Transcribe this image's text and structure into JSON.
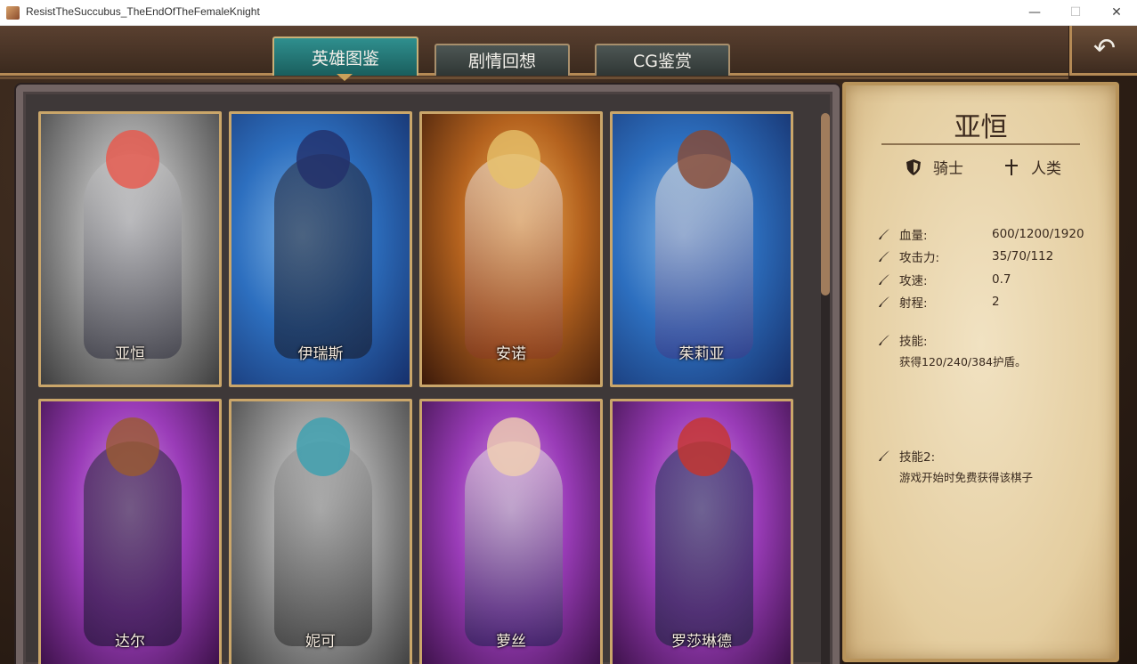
{
  "window": {
    "title": "ResistTheSuccubus_TheEndOfTheFemaleKnight",
    "min_glyph": "—",
    "max_glyph": "☐",
    "close_glyph": "✕"
  },
  "tabs": [
    {
      "label": "英雄图鉴",
      "active": true
    },
    {
      "label": "剧情回想",
      "active": false
    },
    {
      "label": "CG鉴赏",
      "active": false
    }
  ],
  "back_button": {
    "icon": "back-arrow-icon",
    "glyph": "↶"
  },
  "heroes": [
    {
      "name": "亚恒",
      "background": "grey"
    },
    {
      "name": "伊瑞斯",
      "background": "blue"
    },
    {
      "name": "安诺",
      "background": "orange"
    },
    {
      "name": "茱莉亚",
      "background": "blue"
    },
    {
      "name": "达尔",
      "background": "purple"
    },
    {
      "name": "妮可",
      "background": "grey"
    },
    {
      "name": "萝丝",
      "background": "purple"
    },
    {
      "name": "罗莎琳德",
      "background": "purple"
    }
  ],
  "info": {
    "name": "亚恒",
    "class": {
      "icon": "shield-icon",
      "label": "骑士"
    },
    "race": {
      "icon": "cross-icon",
      "label": "人类"
    },
    "stats": [
      {
        "label": "血量:",
        "value": "600/1200/1920"
      },
      {
        "label": "攻击力:",
        "value": "35/70/112"
      },
      {
        "label": "攻速:",
        "value": "0.7"
      },
      {
        "label": "射程:",
        "value": "2"
      }
    ],
    "skill1": {
      "label": "技能:",
      "desc": "获得120/240/384护盾。"
    },
    "skill2": {
      "label": "技能2:",
      "desc": "游戏开始时免费获得该棋子"
    }
  },
  "colors": {
    "active_tab": "#1f7372",
    "inactive_tab": "#3a4240",
    "gold_border": "#caa66a",
    "parchment": "#ead7ad"
  }
}
